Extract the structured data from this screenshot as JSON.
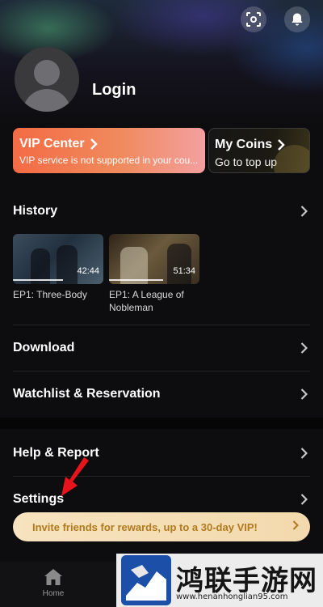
{
  "header": {
    "icons": [
      "scan-icon",
      "bell-icon"
    ]
  },
  "profile": {
    "login_label": "Login"
  },
  "vip_card": {
    "title": "VIP Center",
    "subtitle": "VIP service is not supported in your cou..."
  },
  "coins_card": {
    "title": "My Coins",
    "subtitle": "Go to top up"
  },
  "history": {
    "label": "History",
    "items": [
      {
        "title": "EP1: Three-Body",
        "duration": "42:44",
        "progress": 0.55
      },
      {
        "title": "EP1: A League of Nobleman",
        "duration": "51:34",
        "progress": 0.6
      }
    ]
  },
  "menu": {
    "download": "Download",
    "watchlist": "Watchlist & Reservation",
    "help": "Help & Report",
    "settings": "Settings"
  },
  "invite_banner": {
    "text": "Invite friends for rewards, up to a 30-day VIP!"
  },
  "bottom_nav": {
    "home": "Home"
  },
  "watermark": {
    "title": "鸿联手游网",
    "url": "www.henanhonglian95.com"
  },
  "colors": {
    "accent_orange": "#f46b45",
    "invite_bg": "#f7e3bf",
    "invite_text": "#b07a1e",
    "annotation_arrow": "#e8141c"
  }
}
